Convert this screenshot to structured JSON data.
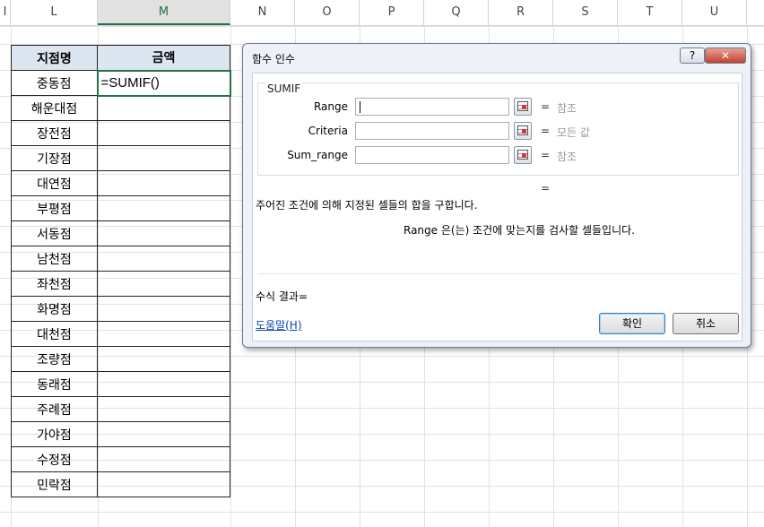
{
  "columns": [
    "I",
    "L",
    "M",
    "N",
    "O",
    "P",
    "Q",
    "R",
    "S",
    "T",
    "U"
  ],
  "selected_column": "M",
  "table": {
    "header": [
      "지점명",
      "금액"
    ],
    "active_cell_formula": "=SUMIF()",
    "branches": [
      "중동점",
      "해운대점",
      "장전점",
      "기장점",
      "대연점",
      "부평점",
      "서동점",
      "남천점",
      "좌천점",
      "화명점",
      "대천점",
      "조량점",
      "동래점",
      "주례점",
      "가야점",
      "수정점",
      "민락점"
    ]
  },
  "dialog": {
    "title": "함수 인수",
    "help_button": "?",
    "close_button": "✕",
    "function_name": "SUMIF",
    "args": [
      {
        "label": "Range",
        "eq": "=",
        "hint": "참조"
      },
      {
        "label": "Criteria",
        "eq": "=",
        "hint": "모든 값"
      },
      {
        "label": "Sum_range",
        "eq": "=",
        "hint": "참조"
      }
    ],
    "result_eq": "=",
    "description": "주어진 조건에 의해 지정된 셀들의 합을 구합니다.",
    "arg_description": "Range  은(는) 조건에 맞는지를 검사할 셀들입니다.",
    "formula_result_label": "수식 결과=",
    "help_link": "도움말(H)",
    "ok_label": "확인",
    "cancel_label": "취소"
  }
}
